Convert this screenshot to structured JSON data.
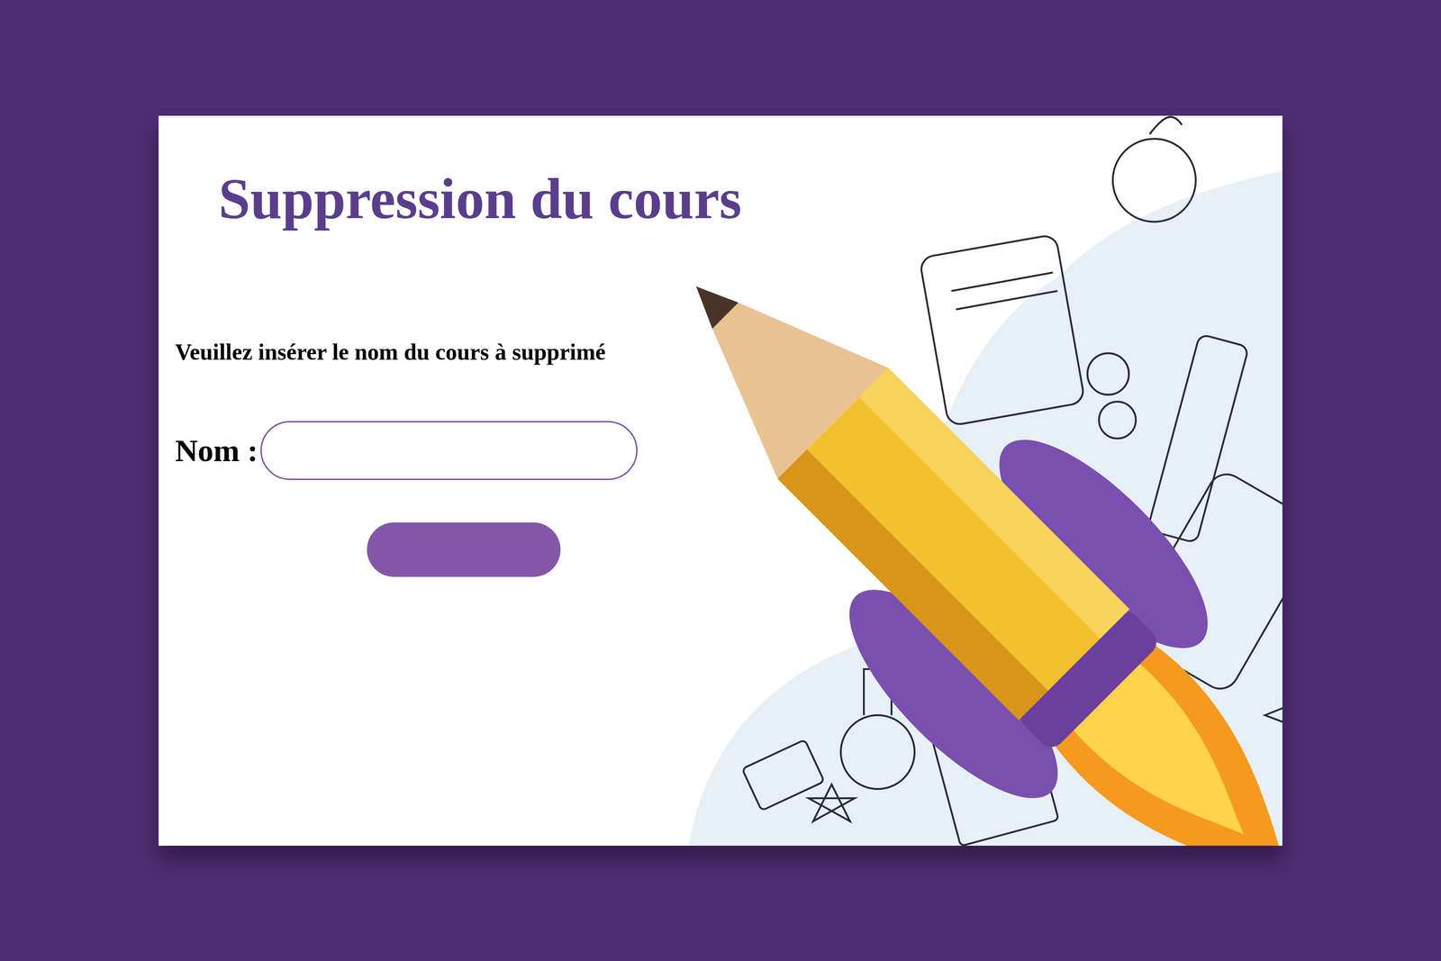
{
  "page": {
    "title": "Suppression du cours",
    "instruction": "Veuillez insérer le nom du cours à supprimé"
  },
  "form": {
    "label": "Nom :",
    "value": ""
  },
  "submit_button": {
    "disabled": false
  }
}
